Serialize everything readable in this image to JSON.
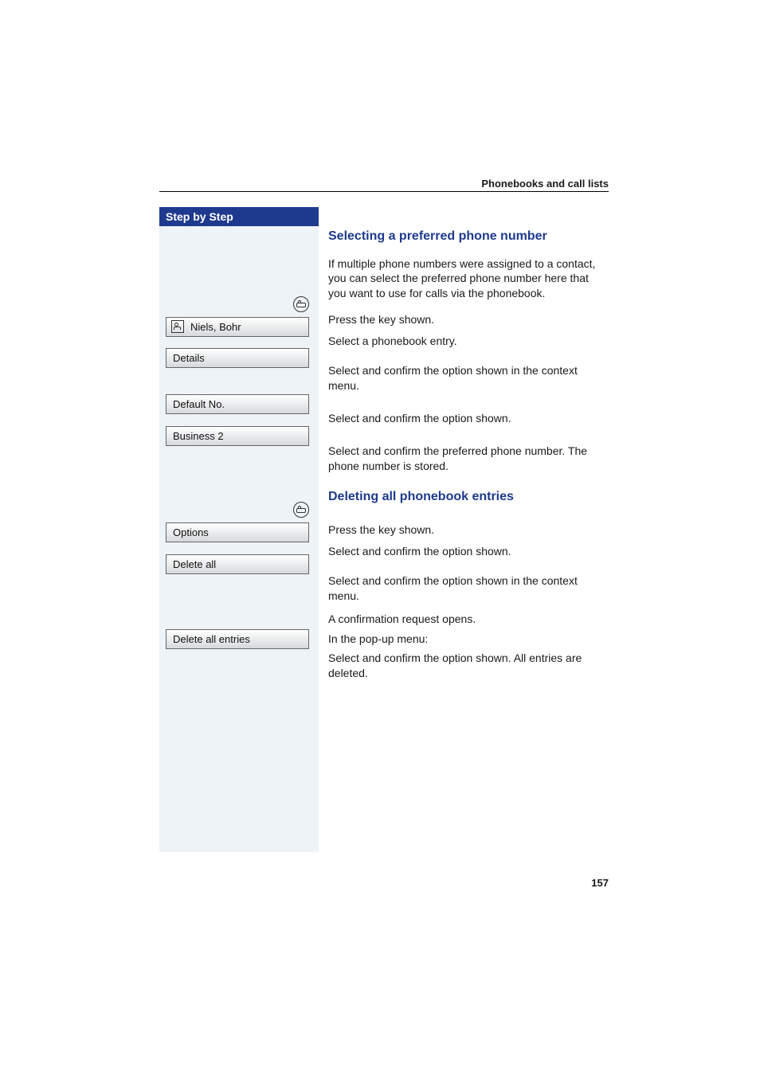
{
  "running_head": "Phonebooks and call lists",
  "page_number": "157",
  "sidebar_header": "Step by Step",
  "section1": {
    "title": "Selecting a preferred phone number",
    "intro": "If multiple phone numbers were assigned to a contact, you can select the preferred phone number here that you want to use for calls via the phonebook.",
    "key_text": "Press the key shown.",
    "entry_name": "Niels, Bohr",
    "entry_text": "Select a phonebook entry.",
    "details_label": "Details",
    "details_text": "Select and confirm the option shown in the context menu.",
    "defaultno_label": "Default No.",
    "defaultno_text": "Select and confirm the option shown.",
    "business2_label": "Business 2",
    "business2_text": "Select and confirm the preferred phone number. The phone number is stored."
  },
  "section2": {
    "title": "Deleting all phonebook entries",
    "key_text": "Press the key shown.",
    "options_label": "Options",
    "options_text": "Select and confirm the option shown.",
    "deleteall_label": "Delete all",
    "deleteall_text": "Select and confirm the option shown in the context menu.",
    "confirm_line": "A confirmation request opens.",
    "popup_line": "In the pop-up menu:",
    "delentries_label": "Delete all entries",
    "delentries_text": "Select and confirm the option shown. All entries are deleted."
  }
}
